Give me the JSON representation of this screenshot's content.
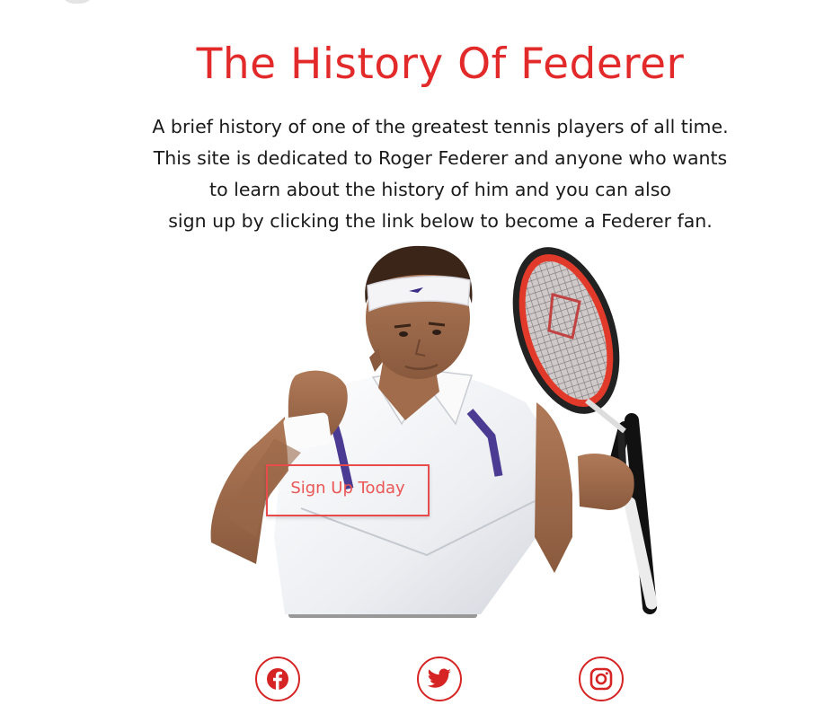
{
  "header": {
    "title": "The History Of Federer"
  },
  "intro": {
    "lines": [
      "A brief history of one of the greatest tennis players of all time.",
      "This site is dedicated to Roger Federer and anyone who wants",
      "to learn about the history of him and you can also",
      "sign up by clicking the link below to become a Federer fan."
    ]
  },
  "hero": {
    "image_subject": "tennis player with racket photo"
  },
  "cta": {
    "signup_label": "Sign Up Today"
  },
  "social": {
    "links": [
      {
        "icon": "facebook-icon"
      },
      {
        "icon": "twitter-icon"
      },
      {
        "icon": "instagram-icon"
      }
    ]
  },
  "colors": {
    "accent": "#e32a2a",
    "text": "#1a1a1a",
    "background": "#ffffff"
  }
}
